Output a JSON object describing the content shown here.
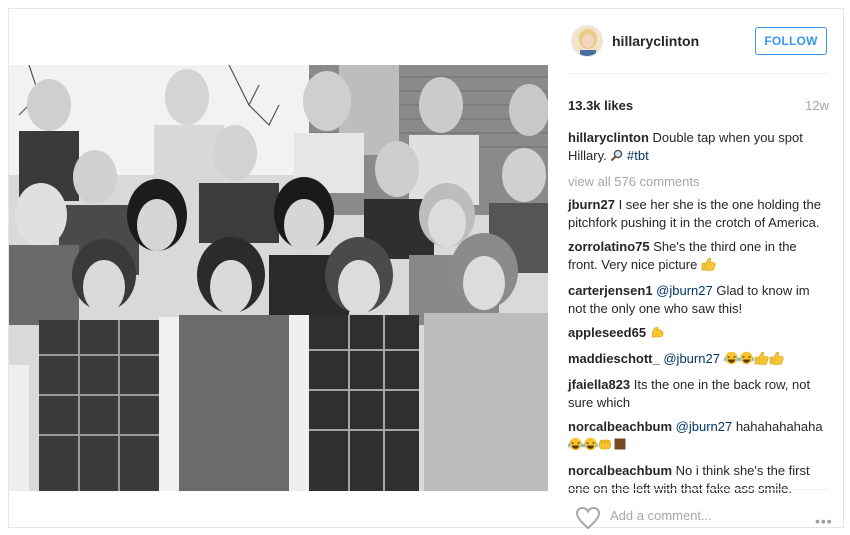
{
  "post": {
    "username": "hillaryclinton",
    "follow_label": "FOLLOW",
    "likes": "13.3k likes",
    "age": "12w",
    "caption": {
      "user": "hillaryclinton",
      "text": " Double tap when you spot Hillary. ",
      "tag": "#tbt"
    },
    "view_all": "view all 576 comments",
    "comments": [
      {
        "user": "jburn27",
        "text": " I see her she is the one holding the pitchfork pushing it in the crotch of America."
      },
      {
        "user": "zorrolatino75",
        "text": " She's the third one in the front. Very nice picture "
      },
      {
        "user": "carterjensen1",
        "mention": " @jburn27",
        "text": " Glad to know im not the only one who saw this!"
      },
      {
        "user": "appleseed65",
        "text": " "
      },
      {
        "user": "maddieschott_",
        "mention": " @jburn27",
        "text": " "
      },
      {
        "user": "jfaiella823",
        "text": " Its the one in the back row, not sure which"
      },
      {
        "user": "norcalbeachbum",
        "mention": " @jburn27",
        "text": " hahahahahaha "
      },
      {
        "user": "norcalbeachbum",
        "text": " No i think she's the first one on the left with that fake ass smile."
      }
    ],
    "add_comment_placeholder": "Add a comment...",
    "icons": {
      "avatar": "profile-avatar",
      "magnifier": "magnifying-glass-emoji",
      "thumbs_up": "thumbs-up-emoji",
      "flexed_biceps": "flexed-biceps-emoji",
      "laughing": "tears-of-joy-emoji",
      "fist": "oncoming-fist-emoji",
      "square": "brown-square-emoji",
      "heart": "heart-icon",
      "more": "more-options-icon"
    },
    "colors": {
      "link": "#003569",
      "follow": "#3897f0",
      "muted": "#a5a7aa"
    }
  }
}
